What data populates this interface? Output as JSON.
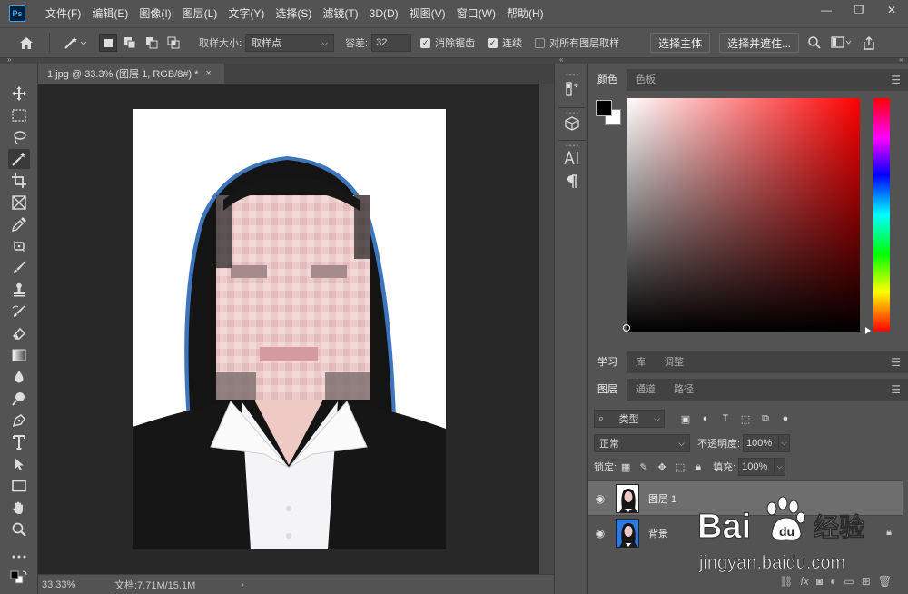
{
  "app": {
    "logo": "Ps",
    "menus": [
      "文件(F)",
      "编辑(E)",
      "图像(I)",
      "图层(L)",
      "文字(Y)",
      "选择(S)",
      "滤镜(T)",
      "3D(D)",
      "视图(V)",
      "窗口(W)",
      "帮助(H)"
    ],
    "window_controls": {
      "minimize": "—",
      "restore": "❐",
      "close": "✕"
    }
  },
  "options_bar": {
    "sample_size_label": "取样大小:",
    "sample_size_value": "取样点",
    "tolerance_label": "容差:",
    "tolerance_value": "32",
    "anti_alias_label": "消除锯齿",
    "anti_alias_checked": true,
    "contiguous_label": "连续",
    "contiguous_checked": true,
    "sample_all_layers_label": "对所有图层取样",
    "sample_all_layers_checked": false,
    "select_subject_label": "选择主体",
    "select_mask_label": "选择并遮住..."
  },
  "document": {
    "tab_title": "1.jpg @ 33.3% (图层 1, RGB/8#) *",
    "close_glyph": "×"
  },
  "status_bar": {
    "zoom": "33.33%",
    "doc_info": "文档:7.71M/15.1M",
    "arrow": "›"
  },
  "color_panel": {
    "tabs": [
      "颜色",
      "色板"
    ],
    "foreground": "#000000",
    "background": "#ffffff"
  },
  "learn_panel": {
    "tabs": [
      "学习",
      "库",
      "调整"
    ]
  },
  "layers_panel": {
    "tabs": [
      "图层",
      "通道",
      "路径"
    ],
    "filter_label": "类型",
    "blend_mode": "正常",
    "opacity_label": "不透明度:",
    "opacity_value": "100%",
    "lock_label": "锁定:",
    "fill_label": "填充:",
    "fill_value": "100%",
    "layers": [
      {
        "name": "图层 1",
        "selected": true,
        "locked": false
      },
      {
        "name": "背景",
        "selected": false,
        "locked": true
      }
    ]
  },
  "watermark": {
    "brand": "Bai",
    "brand2": "du",
    "suffix": "经验",
    "url": "jingyan.baidu.com"
  },
  "colors": {
    "ui_bg": "#535353",
    "canvas_bg": "#282828",
    "accent": "#31a8ff"
  }
}
